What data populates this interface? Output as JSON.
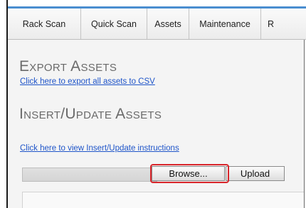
{
  "tabs": [
    {
      "label": "Rack Scan"
    },
    {
      "label": "Quick Scan"
    },
    {
      "label": "Assets"
    },
    {
      "label": "Maintenance"
    },
    {
      "label": "R"
    }
  ],
  "export_section": {
    "heading": "Export Assets",
    "link": "Click here to export all assets to CSV"
  },
  "insert_section": {
    "heading": "Insert/Update Assets",
    "link": "Click here to view Insert/Update instructions"
  },
  "file_upload": {
    "browse_label": "Browse...",
    "upload_label": "Upload"
  },
  "colors": {
    "accent_rule": "#4a8ed0",
    "link": "#1f55c9",
    "highlight": "#d8262c",
    "heading": "#6a6a6a"
  }
}
